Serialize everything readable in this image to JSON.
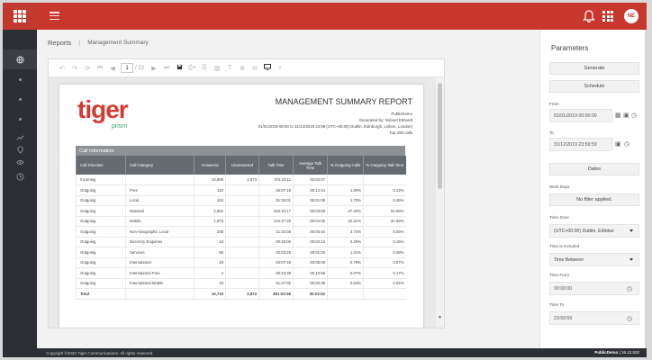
{
  "header": {
    "avatar_initials": "NE"
  },
  "breadcrumb": {
    "root": "Reports",
    "sep": "|",
    "current": "Management Summary"
  },
  "toolbar": {
    "page_current": "1",
    "page_total": "/ 23"
  },
  "report": {
    "logo_main": "tiger",
    "logo_sub": "prism",
    "title": "MANAGEMENT SUMMARY REPORT",
    "meta_lines": [
      "PublicDemo",
      "Generated by: Noland Ekhardt",
      "01/01/2019 00:00 to 31/12/2019 23:59 (UTC+00:00) Dublin, Edinburgh, Lisbon, London)",
      "Top 250 calls"
    ],
    "section_title": "Call Information",
    "columns": [
      "Call Direction",
      "Call Category",
      "Answered",
      "Unanswered",
      "Talk Time",
      "Average Talk Time",
      "% Outgoing Calls",
      "% Outgoing Talk Time"
    ],
    "rows": [
      [
        "Incoming",
        "",
        "10,889",
        "2,873",
        "374:23:11",
        "00:02:07",
        "",
        ""
      ],
      [
        "Outgoing",
        "Free",
        "110",
        "",
        "26:07:18",
        "00:14:14",
        "1.80%",
        "6.12%"
      ],
      [
        "Outgoing",
        "Local",
        "104",
        "",
        "01:39:01",
        "00:01:08",
        "1.70%",
        "0.46%"
      ],
      [
        "Outgoing",
        "National",
        "2,502",
        "",
        "233:10:17",
        "00:03:59",
        "37.20%",
        "54.65%"
      ],
      [
        "Outgoing",
        "Mobile",
        "1,973",
        "",
        "134:47:20",
        "00:04:05",
        "32.21%",
        "31.59%"
      ],
      [
        "Outgoing",
        "Non-Geographic Local",
        "235",
        "",
        "21:33:38",
        "00:05:40",
        "3.73%",
        "5.05%"
      ],
      [
        "Outgoing",
        "Directory Enquiries",
        "18",
        "",
        "00:40:00",
        "00:02:13",
        "0.29%",
        "0.16%"
      ],
      [
        "Outgoing",
        "Services",
        "86",
        "",
        "02:03:25",
        "00:01:26",
        "1.41%",
        "0.48%"
      ],
      [
        "Outgoing",
        "International",
        "48",
        "",
        "04:07:48",
        "00:05:09",
        "0.79%",
        "0.97%"
      ],
      [
        "Outgoing",
        "International Free",
        "4",
        "",
        "00:43:39",
        "00:10:59",
        "0.07%",
        "0.17%"
      ],
      [
        "Outgoing",
        "International Mobile",
        "33",
        "",
        "01:27:02",
        "00:02:38",
        "0.54%",
        "0.34%"
      ]
    ],
    "total": [
      "Total",
      "",
      "16,715",
      "2,873",
      "801:02:59",
      "00:02:52",
      "",
      ""
    ]
  },
  "panel": {
    "title": "Parameters",
    "generate": "Generate",
    "schedule": "Schedule",
    "from_label": "From",
    "from_value": "01/01/2019 00:00:00",
    "to_label": "To",
    "to_value": "31/12/2019 23:59:59",
    "dates_btn": "Dates",
    "workdays_label": "Work Days",
    "workdays_value": "No filter applied.",
    "timezone_label": "Time Zone",
    "timezone_value": "(UTC+00:00) Dublin, Edinbur",
    "time_included_label": "Time is Included",
    "time_included_value": "Time Between",
    "time_from_label": "Time From",
    "time_from_value": "00:00:00",
    "time_to_label": "Time To",
    "time_to_value": "23:59:59"
  },
  "footer": {
    "copyright": "Copyright ©2020 Tiger Communications. All rights reserved.",
    "tenant": "PublicDemo",
    "sep": "|",
    "version": "16.12.532"
  }
}
